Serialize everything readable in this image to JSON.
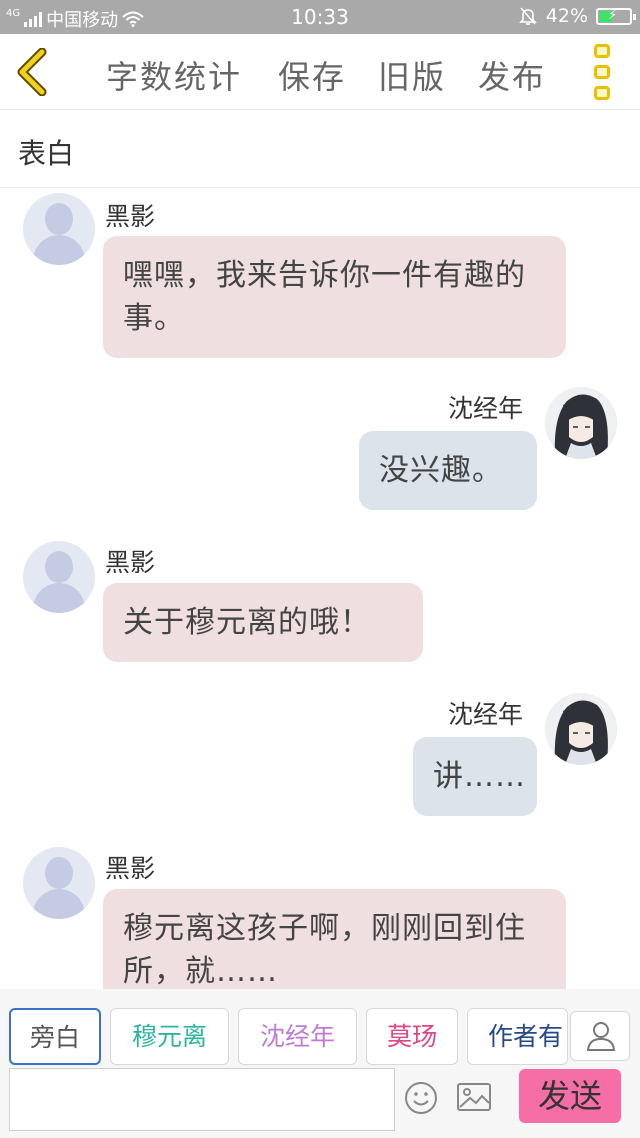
{
  "status_bar": {
    "network": "4G",
    "carrier": "中国移动",
    "time": "10:33",
    "battery": "42%"
  },
  "toolbar": {
    "word_count": "字数统计",
    "save": "保存",
    "old_version": "旧版",
    "publish": "发布"
  },
  "chapter_title": "表白",
  "messages": [
    {
      "side": "left",
      "name": "黑影",
      "text": "嘿嘿，我来告诉你一件有趣的事。"
    },
    {
      "side": "right",
      "name": "沈经年",
      "text": "没兴趣。"
    },
    {
      "side": "left",
      "name": "黑影",
      "text": "关于穆元离的哦！"
    },
    {
      "side": "right",
      "name": "沈经年",
      "text": "讲……"
    },
    {
      "side": "left",
      "name": "黑影",
      "text": "穆元离这孩子啊，刚刚回到住所，就……"
    }
  ],
  "roles": [
    {
      "label": "旁白",
      "color": "#555555"
    },
    {
      "label": "穆元离",
      "color": "#2bb5a0"
    },
    {
      "label": "沈经年",
      "color": "#c07ad6"
    },
    {
      "label": "莫玚",
      "color": "#e0458a"
    },
    {
      "label": "作者有",
      "color": "#244a8a"
    }
  ],
  "input": {
    "placeholder": ""
  },
  "send_label": "发送",
  "colors": {
    "status_bar": "#a9a9a9",
    "left_bubble": "#f0dfe0",
    "right_bubble": "#dde3ea",
    "send_button": "#f56ea6",
    "accent_yellow": "#e8c000"
  }
}
